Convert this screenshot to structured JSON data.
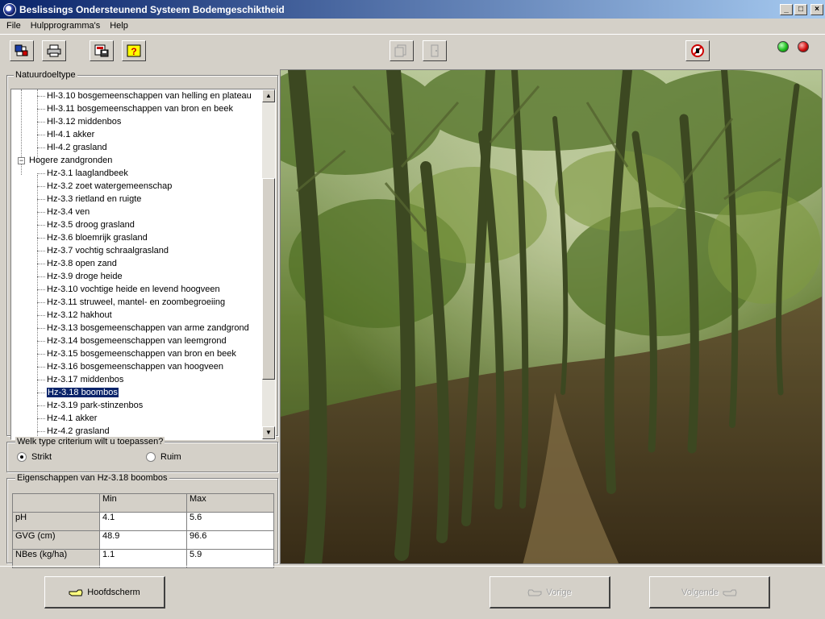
{
  "window": {
    "title": "Beslissings Ondersteunend Systeem Bodemgeschiktheid",
    "controls": [
      "_",
      "□",
      "×"
    ]
  },
  "menu": [
    "File",
    "Hulpprogramma's",
    "Help"
  ],
  "toolbar": {
    "left_buttons": [
      "open-icon",
      "print-icon",
      "save-icon",
      "help-icon"
    ],
    "middle_buttons": [
      "copy-icon",
      "door-icon"
    ],
    "right_button": "stop-icon",
    "status_lights": {
      "green": "#1fbf1f",
      "red": "#d01010"
    }
  },
  "natuurdoeltype": {
    "legend": "Natuurdoeltype",
    "items_top": [
      "Hl-3.10 bosgemeenschappen van helling en plateau",
      "Hl-3.11 bosgemeenschappen van bron en beek",
      "Hl-3.12 middenbos",
      "Hl-4.1 akker",
      "Hl-4.2 grasland"
    ],
    "group_label": "Hogere zandgronden",
    "group_items": [
      "Hz-3.1 laaglandbeek",
      "Hz-3.2 zoet watergemeenschap",
      "Hz-3.3 rietland en ruigte",
      "Hz-3.4 ven",
      "Hz-3.5 droog grasland",
      "Hz-3.6 bloemrijk grasland",
      "Hz-3.7 vochtig schraalgrasland",
      "Hz-3.8 open zand",
      "Hz-3.9 droge heide",
      "Hz-3.10 vochtige heide en levend hoogveen",
      "Hz-3.11 struweel, mantel- en zoombegroeiing",
      "Hz-3.12 hakhout",
      "Hz-3.13 bosgemeenschappen van arme zandgrond",
      "Hz-3.14 bosgemeenschappen van leemgrond",
      "Hz-3.15 bosgemeenschappen van bron en beek",
      "Hz-3.16 bosgemeenschappen van hoogveen",
      "Hz-3.17 middenbos",
      "Hz-3.18 boombos",
      "Hz-3.19 park-stinzenbos",
      "Hz-4.1 akker",
      "Hz-4.2 grasland"
    ],
    "selected": "Hz-3.18 boombos"
  },
  "criterium": {
    "legend": "Welk type criterium wilt u toepassen?",
    "options": [
      "Strikt",
      "Ruim"
    ],
    "selected": "Strikt"
  },
  "eigenschappen": {
    "legend": "Eigenschappen van Hz-3.18 boombos",
    "columns": [
      "",
      "Min",
      "Max"
    ],
    "rows": [
      {
        "label": "pH",
        "min": "4.1",
        "max": "5.6"
      },
      {
        "label": "GVG (cm)",
        "min": "48.9",
        "max": "96.6"
      },
      {
        "label": "NBes (kg/ha)",
        "min": "1.1",
        "max": "5.9"
      }
    ]
  },
  "navigation": {
    "home": "Hoofdscherm",
    "prev": "Vorige",
    "next": "Volgende"
  }
}
